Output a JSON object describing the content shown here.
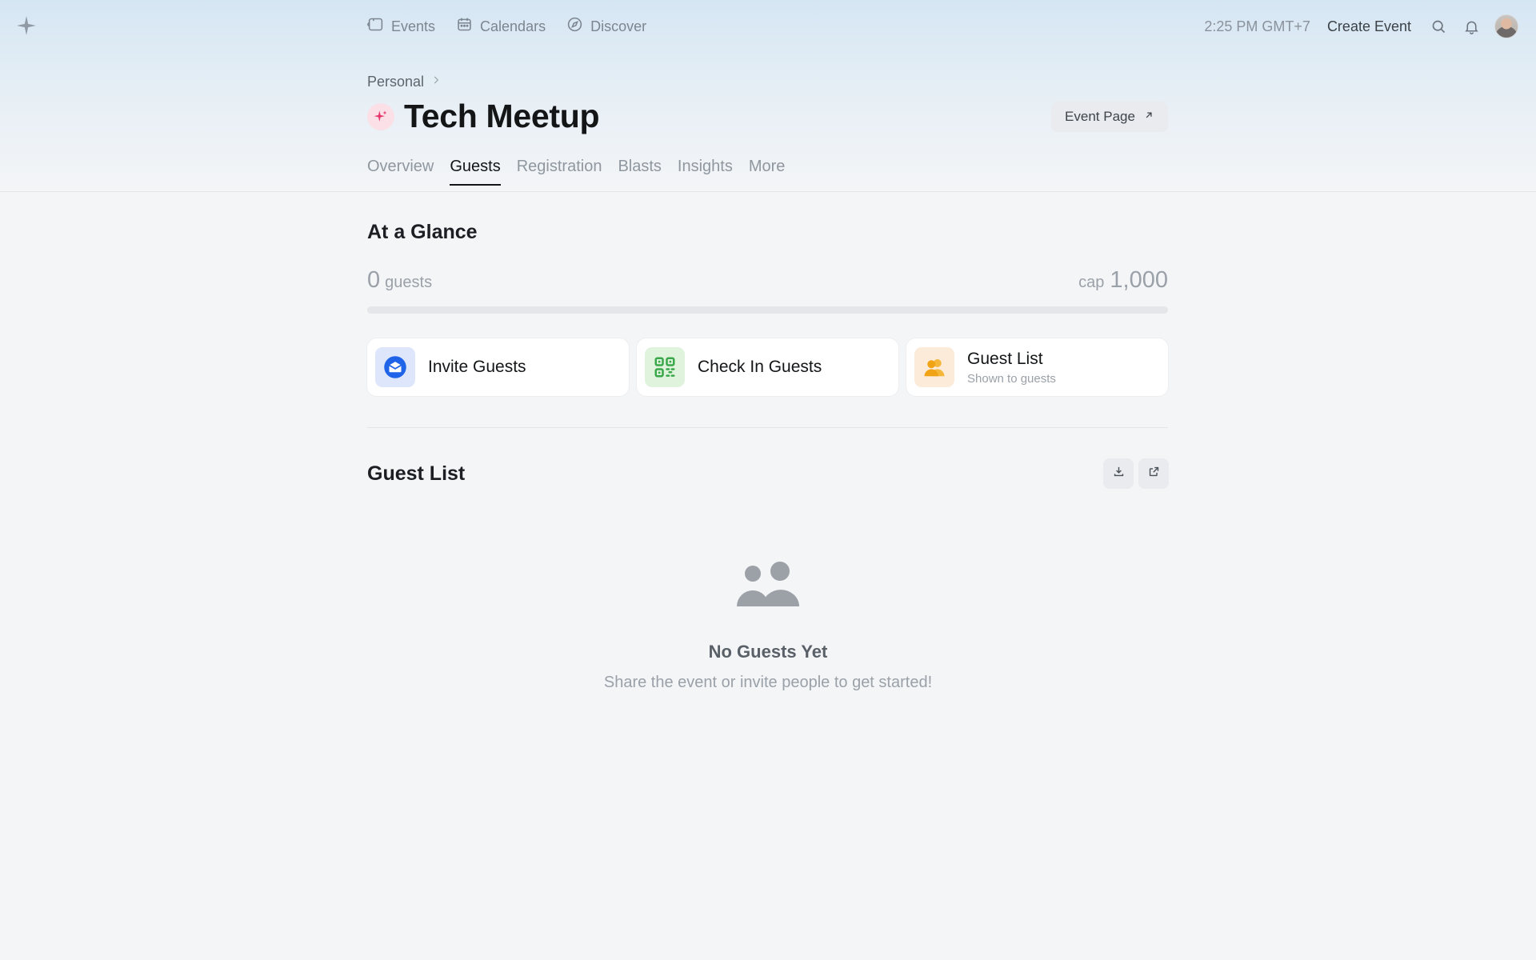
{
  "nav": {
    "links": [
      {
        "label": "Events",
        "icon": "ticket-icon"
      },
      {
        "label": "Calendars",
        "icon": "calendar-icon"
      },
      {
        "label": "Discover",
        "icon": "compass-icon"
      }
    ],
    "time": "2:25 PM GMT+7",
    "create_event": "Create Event"
  },
  "header": {
    "breadcrumb": "Personal",
    "title": "Tech Meetup",
    "event_page_button": "Event Page",
    "tabs": [
      "Overview",
      "Guests",
      "Registration",
      "Blasts",
      "Insights",
      "More"
    ],
    "active_tab": "Guests"
  },
  "glance": {
    "title": "At a Glance",
    "guest_count": "0",
    "guest_unit": "guests",
    "cap_label": "cap",
    "cap_value": "1,000",
    "progress_fraction": 0
  },
  "cards": [
    {
      "label": "Invite Guests",
      "icon": "envelope-icon",
      "bg": "#dde6fb",
      "color": "#1f63e8"
    },
    {
      "label": "Check In Guests",
      "icon": "qr-code-icon",
      "bg": "#dff3dd",
      "color": "#3aa84a"
    },
    {
      "label": "Guest List",
      "sub": "Shown to guests",
      "icon": "users-icon",
      "bg": "#fcebd9",
      "color": "#f1a316"
    }
  ],
  "guest_list": {
    "title": "Guest List",
    "empty_title": "No Guests Yet",
    "empty_sub": "Share the event or invite people to get started!"
  },
  "colors": {
    "accent": "#131517",
    "muted": "#9aa1a8",
    "event_icon": "#e5376b"
  }
}
